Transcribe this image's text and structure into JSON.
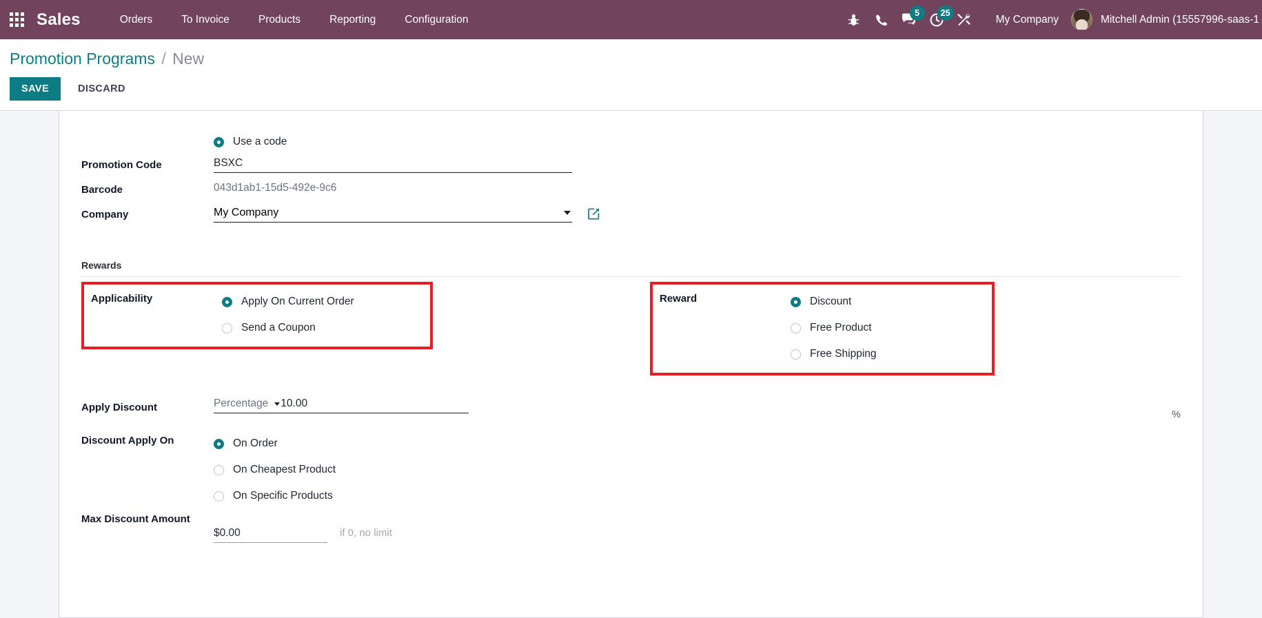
{
  "navbar": {
    "apps_icon": "apps-grid-icon",
    "brand": "Sales",
    "menu": [
      {
        "label": "Orders"
      },
      {
        "label": "To Invoice"
      },
      {
        "label": "Products"
      },
      {
        "label": "Reporting"
      },
      {
        "label": "Configuration"
      }
    ],
    "sys_icons": [
      {
        "name": "bug-icon",
        "badge": null
      },
      {
        "name": "phone-icon",
        "badge": null
      },
      {
        "name": "messages-icon",
        "badge": "5"
      },
      {
        "name": "activities-clock-icon",
        "badge": "25"
      },
      {
        "name": "tools-icon",
        "badge": null
      }
    ],
    "company": "My Company",
    "user": "Mitchell Admin (15557996-saas-1",
    "badge_color": "#0d7c84",
    "background_color": "#71435c"
  },
  "control_panel": {
    "breadcrumb_parent": "Promotion Programs",
    "breadcrumb_separator": "/",
    "breadcrumb_current": "New",
    "save_label": "SAVE",
    "discard_label": "DISCARD",
    "save_color": "#0d7c84"
  },
  "form": {
    "use_a_code": {
      "label": "Use a code",
      "selected": true
    },
    "promotion_code": {
      "label": "Promotion Code",
      "value": "BSXC"
    },
    "barcode": {
      "label": "Barcode",
      "value": "043d1ab1-15d5-492e-9c6"
    },
    "company": {
      "label": "Company",
      "value": "My Company",
      "external_link_icon": "external-link-icon"
    },
    "rewards_section_title": "Rewards",
    "applicability": {
      "label": "Applicability",
      "highlighted": true,
      "highlight_color": "#ec1c24",
      "options": [
        {
          "label": "Apply On Current Order",
          "selected": true
        },
        {
          "label": "Send a Coupon",
          "selected": false
        }
      ]
    },
    "reward": {
      "label": "Reward",
      "highlighted": true,
      "highlight_color": "#ec1c24",
      "options": [
        {
          "label": "Discount",
          "selected": true
        },
        {
          "label": "Free Product",
          "selected": false
        },
        {
          "label": "Free Shipping",
          "selected": false
        }
      ]
    },
    "apply_discount": {
      "label": "Apply Discount",
      "type": "Percentage",
      "amount": "10.00",
      "suffix": "%"
    },
    "discount_apply_on": {
      "label": "Discount Apply On",
      "options": [
        {
          "label": "On Order",
          "selected": true
        },
        {
          "label": "On Cheapest Product",
          "selected": false
        },
        {
          "label": "On Specific Products",
          "selected": false
        }
      ]
    },
    "max_discount_amount": {
      "label": "Max Discount Amount",
      "value": "$0.00",
      "hint": "if 0, no limit"
    }
  }
}
